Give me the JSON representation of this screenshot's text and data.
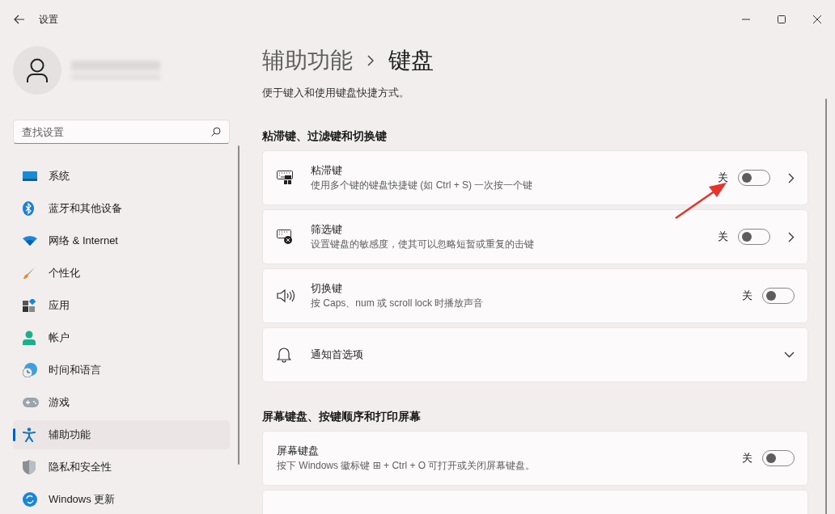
{
  "window": {
    "title": "设置"
  },
  "search": {
    "placeholder": "查找设置"
  },
  "sidebar": {
    "items": [
      {
        "label": "系统",
        "selected": false
      },
      {
        "label": "蓝牙和其他设备",
        "selected": false
      },
      {
        "label": "网络 & Internet",
        "selected": false
      },
      {
        "label": "个性化",
        "selected": false
      },
      {
        "label": "应用",
        "selected": false
      },
      {
        "label": "帐户",
        "selected": false
      },
      {
        "label": "时间和语言",
        "selected": false
      },
      {
        "label": "游戏",
        "selected": false
      },
      {
        "label": "辅助功能",
        "selected": true
      },
      {
        "label": "隐私和安全性",
        "selected": false
      },
      {
        "label": "Windows 更新",
        "selected": false
      }
    ]
  },
  "breadcrumb": {
    "parent": "辅助功能",
    "current": "键盘"
  },
  "description": "便于键入和使用键盘快捷方式。",
  "sections": [
    {
      "heading": "粘滞键、过滤键和切换键",
      "cards": [
        {
          "kind": "toggle-link",
          "title": "粘滞键",
          "subtitle": "使用多个键的键盘快捷键 (如 Ctrl + S) 一次按一个键",
          "state_label": "关",
          "on": false
        },
        {
          "kind": "toggle-link",
          "title": "筛选键",
          "subtitle": "设置键盘的敏感度，使其可以忽略短暂或重复的击键",
          "state_label": "关",
          "on": false
        },
        {
          "kind": "toggle",
          "title": "切换键",
          "subtitle": "按 Caps、num 或 scroll lock 时播放声音",
          "state_label": "关",
          "on": false
        },
        {
          "kind": "expander",
          "title": "通知首选项",
          "expanded": false
        }
      ]
    },
    {
      "heading": "屏幕键盘、按键顺序和打印屏幕",
      "cards": [
        {
          "kind": "toggle",
          "title": "屏幕键盘",
          "subtitle": "按下 Windows 徽标键 ⊞ + Ctrl + O 可打开或关闭屏幕键盘。",
          "state_label": "关",
          "on": false
        },
        {
          "kind": "cut-off"
        }
      ]
    }
  ]
}
